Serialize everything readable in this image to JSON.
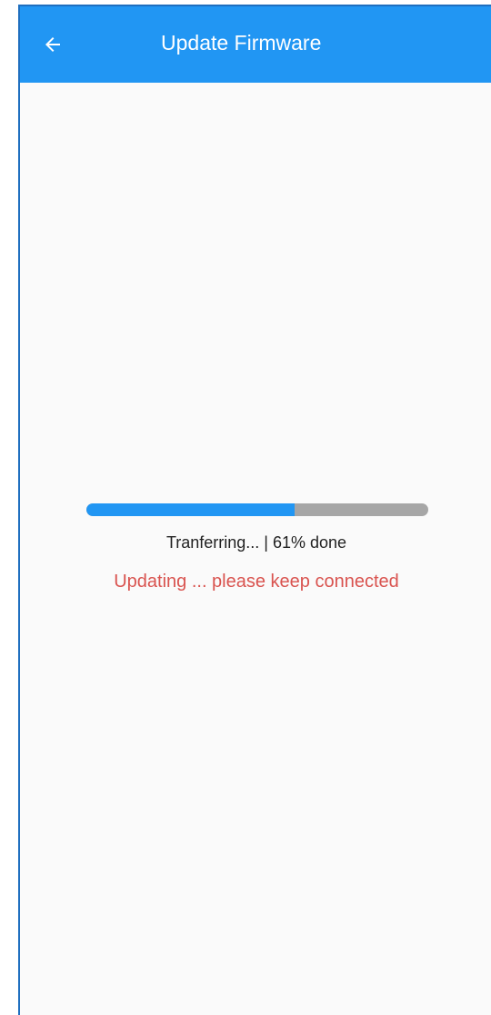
{
  "app_bar": {
    "title": "Update Firmware",
    "back_icon": "arrow-left-icon",
    "color": "#2196f3"
  },
  "progress": {
    "fraction": 0.61,
    "label": "Tranferring... | 61% done",
    "fill_color": "#2196f3",
    "track_color": "#a6a6a6"
  },
  "status": {
    "message": "Updating ... please keep connected",
    "color": "#d9534f"
  }
}
